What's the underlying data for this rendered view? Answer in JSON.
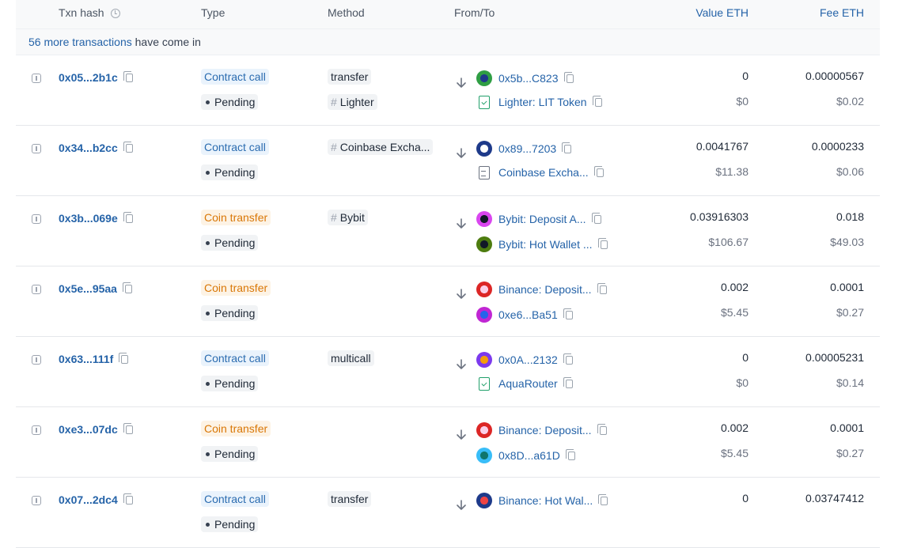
{
  "header": {
    "txn_hash": "Txn hash",
    "type": "Type",
    "method": "Method",
    "from_to": "From/To",
    "value": "Value ETH",
    "fee": "Fee ETH"
  },
  "banner": {
    "link": "56 more transactions",
    "text": " have come in"
  },
  "rows": [
    {
      "hash": "0x05...2b1c",
      "type": "Contract call",
      "type_kind": "call",
      "status": "Pending",
      "method": "transfer",
      "method2": "Lighter",
      "from": "0x5b...C823",
      "from_icon": "avatar-green",
      "to": "Lighter: LIT Token",
      "to_icon": "verified-contract",
      "value": "0",
      "value_usd": "$0",
      "fee": "0.00000567",
      "fee_usd": "$0.02"
    },
    {
      "hash": "0x34...b2cc",
      "type": "Contract call",
      "type_kind": "call",
      "status": "Pending",
      "method": "Coinbase Excha...",
      "method_tag": true,
      "from": "0x89...7203",
      "from_icon": "avatar-coinbase",
      "to": "Coinbase Excha...",
      "to_icon": "contract",
      "value": "0.0041767",
      "value_usd": "$11.38",
      "fee": "0.0000233",
      "fee_usd": "$0.06"
    },
    {
      "hash": "0x3b...069e",
      "type": "Coin transfer",
      "type_kind": "coin",
      "status": "Pending",
      "method": "Bybit",
      "method_tag": true,
      "from": "Bybit: Deposit A...",
      "from_icon": "avatar-purple",
      "to": "Bybit: Hot Wallet ...",
      "to_icon": "avatar-olive",
      "value": "0.03916303",
      "value_usd": "$106.67",
      "fee": "0.018",
      "fee_usd": "$49.03"
    },
    {
      "hash": "0x5e...95aa",
      "type": "Coin transfer",
      "type_kind": "coin",
      "status": "Pending",
      "method": "",
      "from": "Binance: Deposit...",
      "from_icon": "avatar-red",
      "to": "0xe6...Ba51",
      "to_icon": "avatar-magenta",
      "value": "0.002",
      "value_usd": "$5.45",
      "fee": "0.0001",
      "fee_usd": "$0.27"
    },
    {
      "hash": "0x63...111f",
      "type": "Contract call",
      "type_kind": "call",
      "status": "Pending",
      "method": "multicall",
      "from": "0x0A...2132",
      "from_icon": "avatar-violet",
      "to": "AquaRouter",
      "to_icon": "verified-contract",
      "value": "0",
      "value_usd": "$0",
      "fee": "0.00005231",
      "fee_usd": "$0.14"
    },
    {
      "hash": "0xe3...07dc",
      "type": "Coin transfer",
      "type_kind": "coin",
      "status": "Pending",
      "method": "",
      "from": "Binance: Deposit...",
      "from_icon": "avatar-red",
      "to": "0x8D...a61D",
      "to_icon": "avatar-teal",
      "value": "0.002",
      "value_usd": "$5.45",
      "fee": "0.0001",
      "fee_usd": "$0.27"
    },
    {
      "hash": "0x07...2dc4",
      "type": "Contract call",
      "type_kind": "call",
      "status": "Pending",
      "method": "transfer",
      "from": "Binance: Hot Wal...",
      "from_icon": "avatar-navy",
      "to": "",
      "to_icon": "",
      "value": "0",
      "value_usd": "",
      "fee": "0.03747412",
      "fee_usd": ""
    }
  ],
  "colors": {
    "link": "#2563a8",
    "contract_call_bg": "#eaf3fc",
    "coin_transfer_bg": "#fdf3e5",
    "coin_transfer_text": "#d97706",
    "verified": "#22a06b"
  },
  "icons": {
    "avatar-green": [
      "#2f9e44",
      "#1e3a8a"
    ],
    "avatar-coinbase": [
      "#1e3a8a",
      "#ffffff"
    ],
    "avatar-purple": [
      "#d946ef",
      "#111827"
    ],
    "avatar-olive": [
      "#4d7c0f",
      "#111827"
    ],
    "avatar-red": [
      "#dc2626",
      "#fbcfe8"
    ],
    "avatar-magenta": [
      "#c026d3",
      "#2563eb"
    ],
    "avatar-violet": [
      "#7c3aed",
      "#f59e0b"
    ],
    "avatar-teal": [
      "#38bdf8",
      "#0f766e"
    ],
    "avatar-navy": [
      "#1e3a8a",
      "#ef4444"
    ]
  }
}
